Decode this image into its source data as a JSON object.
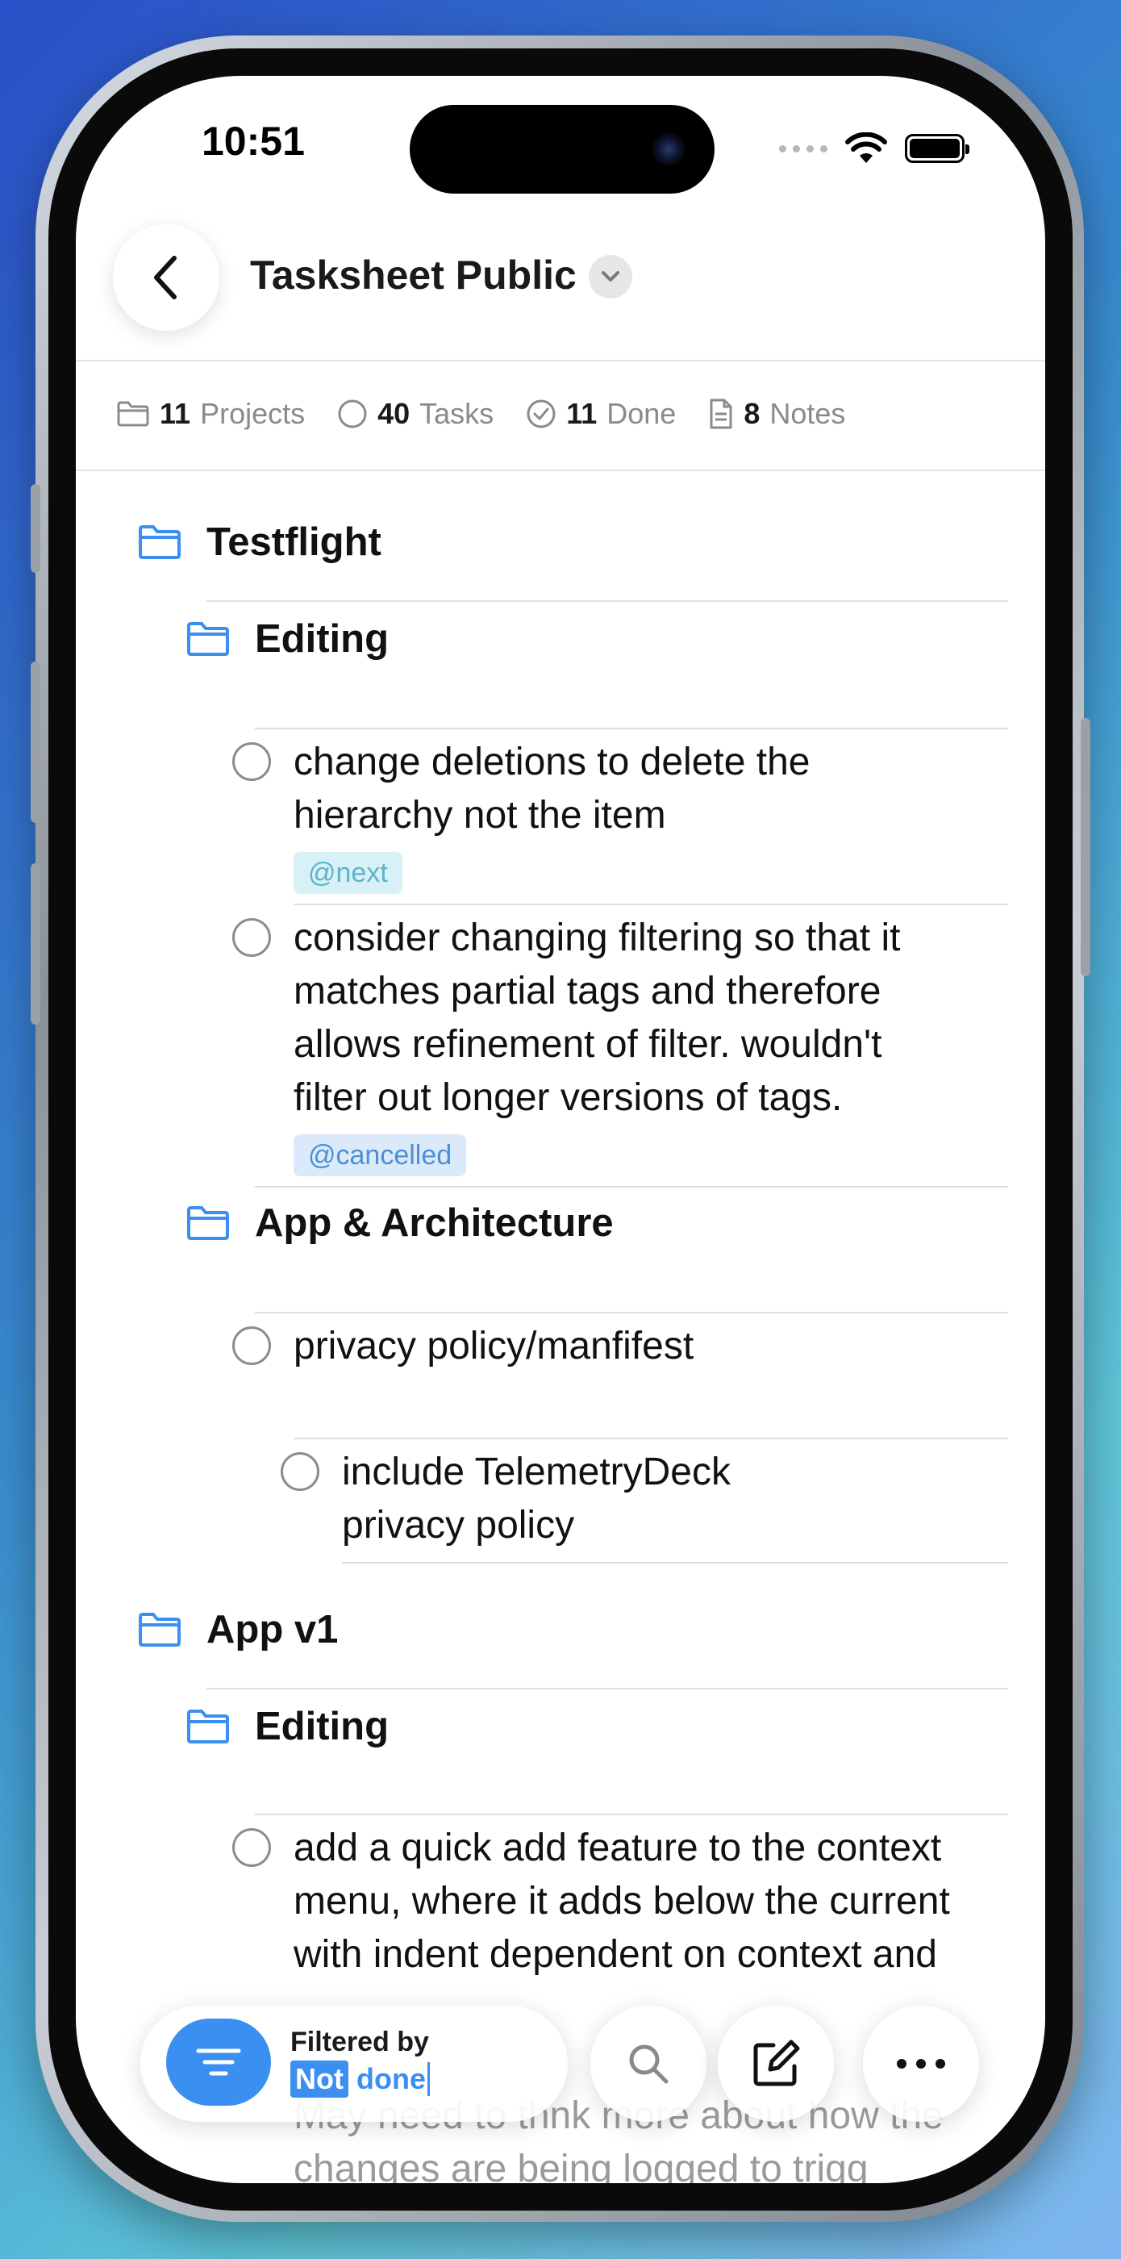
{
  "status_bar": {
    "time": "10:51"
  },
  "header": {
    "title": "Tasksheet Public"
  },
  "stats": {
    "projects": {
      "count": "11",
      "label": "Projects"
    },
    "tasks": {
      "count": "40",
      "label": "Tasks"
    },
    "done": {
      "count": "11",
      "label": "Done"
    },
    "notes": {
      "count": "8",
      "label": "Notes"
    }
  },
  "outline": {
    "testflight": "Testflight",
    "editing_1": "Editing",
    "task_1_line1": "change deletions to delete the",
    "task_1_line2": "hierarchy not the item",
    "tag_next": "@next",
    "task_2_line1": "consider changing filtering so that it",
    "task_2_line2": "matches partial tags and therefore",
    "task_2_line3": "allows refinement of filter. wouldn't",
    "task_2_line4": "filter out longer versions of tags.",
    "tag_cancelled": "@cancelled",
    "app_arch": "App & Architecture",
    "task_3": "privacy policy/manfifest",
    "task_4_line1": "include TelemetryDeck",
    "task_4_line2": "privacy policy",
    "app_v1": "App v1",
    "editing_2": "Editing",
    "task_5_line1": "add a quick add feature to the context",
    "task_5_line2": "menu, where it adds below the current",
    "task_5_line3": "with indent dependent on context and",
    "task_6_line2": "May need to thnk more about how the",
    "task_6_line3": "changes are being logged to trigg"
  },
  "toolbar": {
    "filtered_by": "Filtered by",
    "filter_not": "Not",
    "filter_done": "done"
  }
}
